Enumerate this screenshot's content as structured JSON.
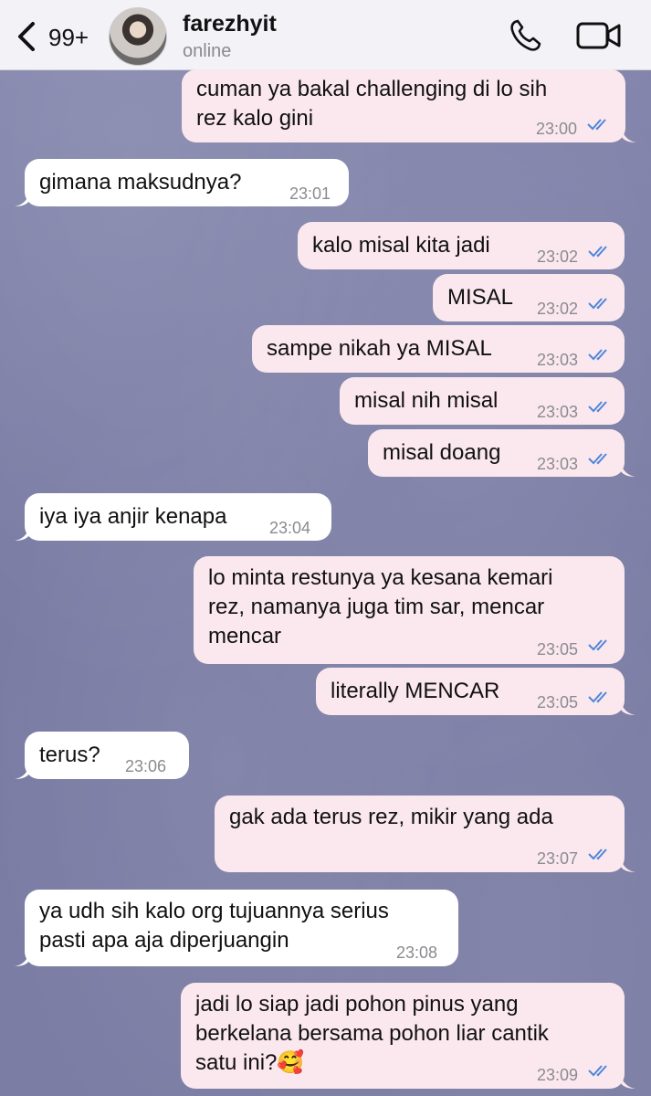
{
  "header": {
    "back_count": "99+",
    "contact_name": "farezhyit",
    "contact_status": "online",
    "icons": [
      "chevron-left-icon",
      "phone-icon",
      "video-icon"
    ]
  },
  "colors": {
    "outgoing_bubble": "#fbe8ee",
    "incoming_bubble": "#ffffff",
    "read_ticks": "#4f86d9",
    "chat_background": "#7d7fa6"
  },
  "messages": [
    {
      "dir": "out",
      "text": "cuman ya bakal challenging di lo sih\nrez kalo gini",
      "time": "23:00"
    },
    {
      "dir": "in",
      "text": "gimana maksudnya?",
      "time": "23:01"
    },
    {
      "dir": "out",
      "text": "kalo misal kita jadi",
      "time": "23:02"
    },
    {
      "dir": "out",
      "text": "MISAL",
      "time": "23:02"
    },
    {
      "dir": "out",
      "text": "sampe nikah ya MISAL",
      "time": "23:03"
    },
    {
      "dir": "out",
      "text": "misal nih misal",
      "time": "23:03"
    },
    {
      "dir": "out",
      "text": "misal doang",
      "time": "23:03"
    },
    {
      "dir": "in",
      "text": "iya iya anjir kenapa",
      "time": "23:04"
    },
    {
      "dir": "out",
      "text": "lo minta restunya ya kesana kemari\nrez, namanya juga tim sar, mencar\nmencar",
      "time": "23:05"
    },
    {
      "dir": "out",
      "text": "literally MENCAR",
      "time": "23:05"
    },
    {
      "dir": "in",
      "text": "terus?",
      "time": "23:06"
    },
    {
      "dir": "out",
      "text": "gak ada terus rez, mikir yang ada",
      "time": "23:07"
    },
    {
      "dir": "in",
      "text": "ya udh sih kalo org tujuannya serius\npasti apa aja diperjuangin",
      "time": "23:08"
    },
    {
      "dir": "out",
      "text": "jadi lo siap jadi pohon pinus yang\nberkelana bersama pohon liar cantik\nsatu ini?🥰",
      "time": "23:09"
    }
  ]
}
